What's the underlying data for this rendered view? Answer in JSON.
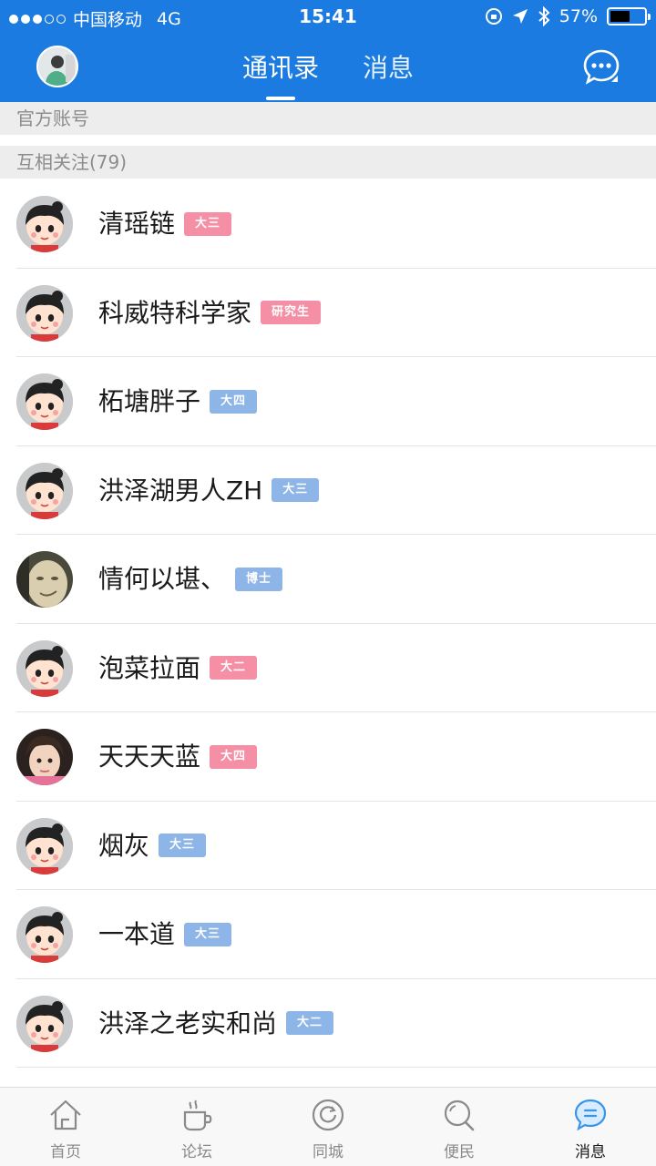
{
  "status_bar": {
    "carrier": "中国移动",
    "network": "4G",
    "time": "15:41",
    "battery": "57%",
    "battery_level": 0.57
  },
  "nav": {
    "tabs": [
      {
        "label": "通讯录",
        "active": true
      },
      {
        "label": "消息",
        "active": false
      }
    ],
    "chat_icon": "chat-bubble-icon"
  },
  "sections": {
    "official": "官方账号",
    "mutual": "互相关注(79)"
  },
  "contacts": [
    {
      "name": "清瑶链",
      "badge": "大三",
      "badge_color": "#f48fa5",
      "avatar": "cartoon"
    },
    {
      "name": "科威特科学家",
      "badge": "研究生",
      "badge_color": "#f48fa5",
      "avatar": "cartoon"
    },
    {
      "name": "柘塘胖子",
      "badge": "大四",
      "badge_color": "#8db5e8",
      "avatar": "cartoon"
    },
    {
      "name": "洪泽湖男人ZH",
      "badge": "大三",
      "badge_color": "#8db5e8",
      "avatar": "cartoon"
    },
    {
      "name": "情何以堪、",
      "badge": "博士",
      "badge_color": "#8db5e8",
      "avatar": "photo"
    },
    {
      "name": "泡菜拉面",
      "badge": "大二",
      "badge_color": "#f48fa5",
      "avatar": "cartoon"
    },
    {
      "name": "天天天蓝",
      "badge": "大四",
      "badge_color": "#f48fa5",
      "avatar": "photo-girl"
    },
    {
      "name": "烟灰",
      "badge": "大三",
      "badge_color": "#8db5e8",
      "avatar": "cartoon"
    },
    {
      "name": "一本道",
      "badge": "大三",
      "badge_color": "#8db5e8",
      "avatar": "cartoon"
    },
    {
      "name": "洪泽之老实和尚",
      "badge": "大二",
      "badge_color": "#8db5e8",
      "avatar": "cartoon"
    }
  ],
  "tab_bar": [
    {
      "label": "首页",
      "icon": "home-icon",
      "active": false
    },
    {
      "label": "论坛",
      "icon": "coffee-cup-icon",
      "active": false
    },
    {
      "label": "同城",
      "icon": "refresh-circle-icon",
      "active": false
    },
    {
      "label": "便民",
      "icon": "search-icon",
      "active": false
    },
    {
      "label": "消息",
      "icon": "message-bubble-icon",
      "active": true
    }
  ],
  "colors": {
    "brand_blue": "#1c7be0",
    "badge_pink": "#f48fa5",
    "badge_blue": "#8db5e8"
  }
}
